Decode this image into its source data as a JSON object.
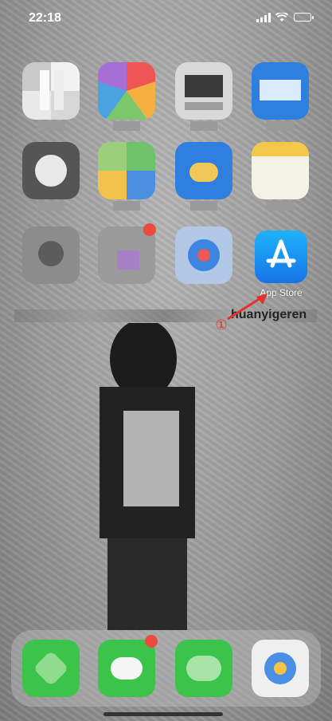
{
  "status_bar": {
    "time": "22:18"
  },
  "arrow_annotation": {
    "marker": "①"
  },
  "home_screen": {
    "app_store": {
      "label": "App Store",
      "icon": "app-store-icon"
    },
    "background_text": "huanyigeren"
  },
  "colors": {
    "app_store_gradient_top": "#1fb3fb",
    "app_store_gradient_bottom": "#1674e8",
    "annotation_red": "#e53030"
  }
}
